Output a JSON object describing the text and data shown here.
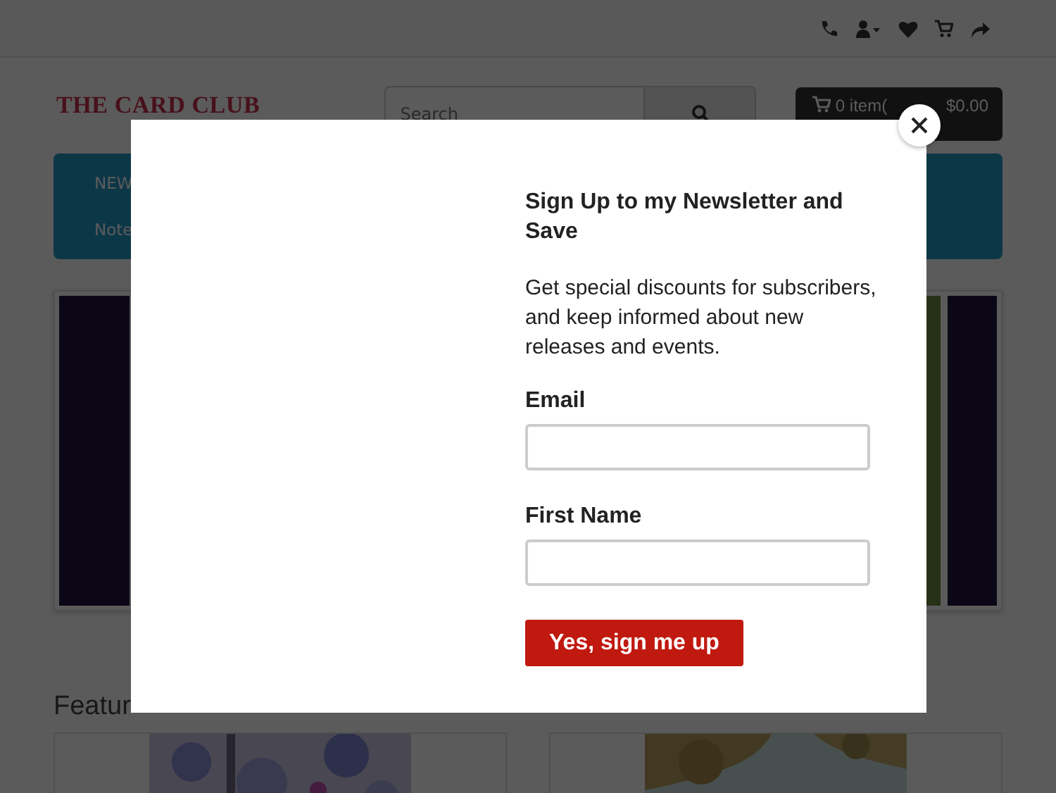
{
  "header": {
    "logo": "THE CARD CLUB",
    "search": {
      "placeholder": "Search"
    },
    "cart": [
      "0 item(",
      "$0.00"
    ]
  },
  "menu": [
    "NEW",
    "Note"
  ],
  "section_heading": "Featur",
  "modal": {
    "title": "Sign Up to my Newsletter and Save",
    "text": "Get special discounts for subscribers, and keep informed about new releases and events.",
    "fields": [
      {
        "label": "Email"
      },
      {
        "label": "First Name"
      }
    ],
    "button": "Yes, sign me up"
  }
}
